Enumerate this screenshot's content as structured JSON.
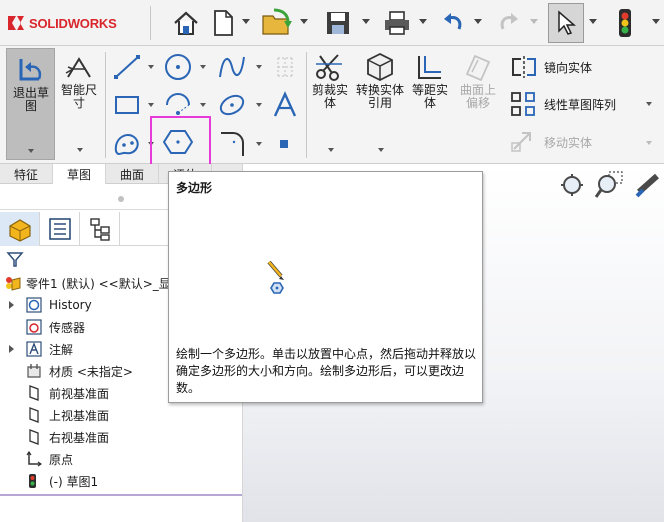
{
  "app": {
    "logo_text": "SOLIDWORKS"
  },
  "ribbon": {
    "exit_sketch": "退出草图",
    "smart_dimension": "智能尺寸",
    "trim": "剪裁实体",
    "convert": "转换实体引用",
    "offset": "等距实体",
    "offset_on_surface": "曲面上偏移",
    "mirror": "镜向实体",
    "linear_pattern": "线性草图阵列",
    "move": "移动实体"
  },
  "tabs": [
    "特征",
    "草图",
    "曲面",
    "评估"
  ],
  "tooltip": {
    "title": "多边形",
    "description": "绘制一个多边形。单击以放置中心点，然后拖动并释放以确定多边形的大小和方向。绘制多边形后，可以更改边数。"
  },
  "tree": {
    "root": "零件1 (默认) <<默认>_显",
    "items": [
      "History",
      "传感器",
      "注解",
      "材质 <未指定>",
      "前视基准面",
      "上视基准面",
      "右视基准面",
      "原点",
      "(-) 草图1"
    ]
  },
  "colors": {
    "highlight": "#e63ad9",
    "brand_red": "#d9262c",
    "icon_blue": "#2a66b5"
  }
}
